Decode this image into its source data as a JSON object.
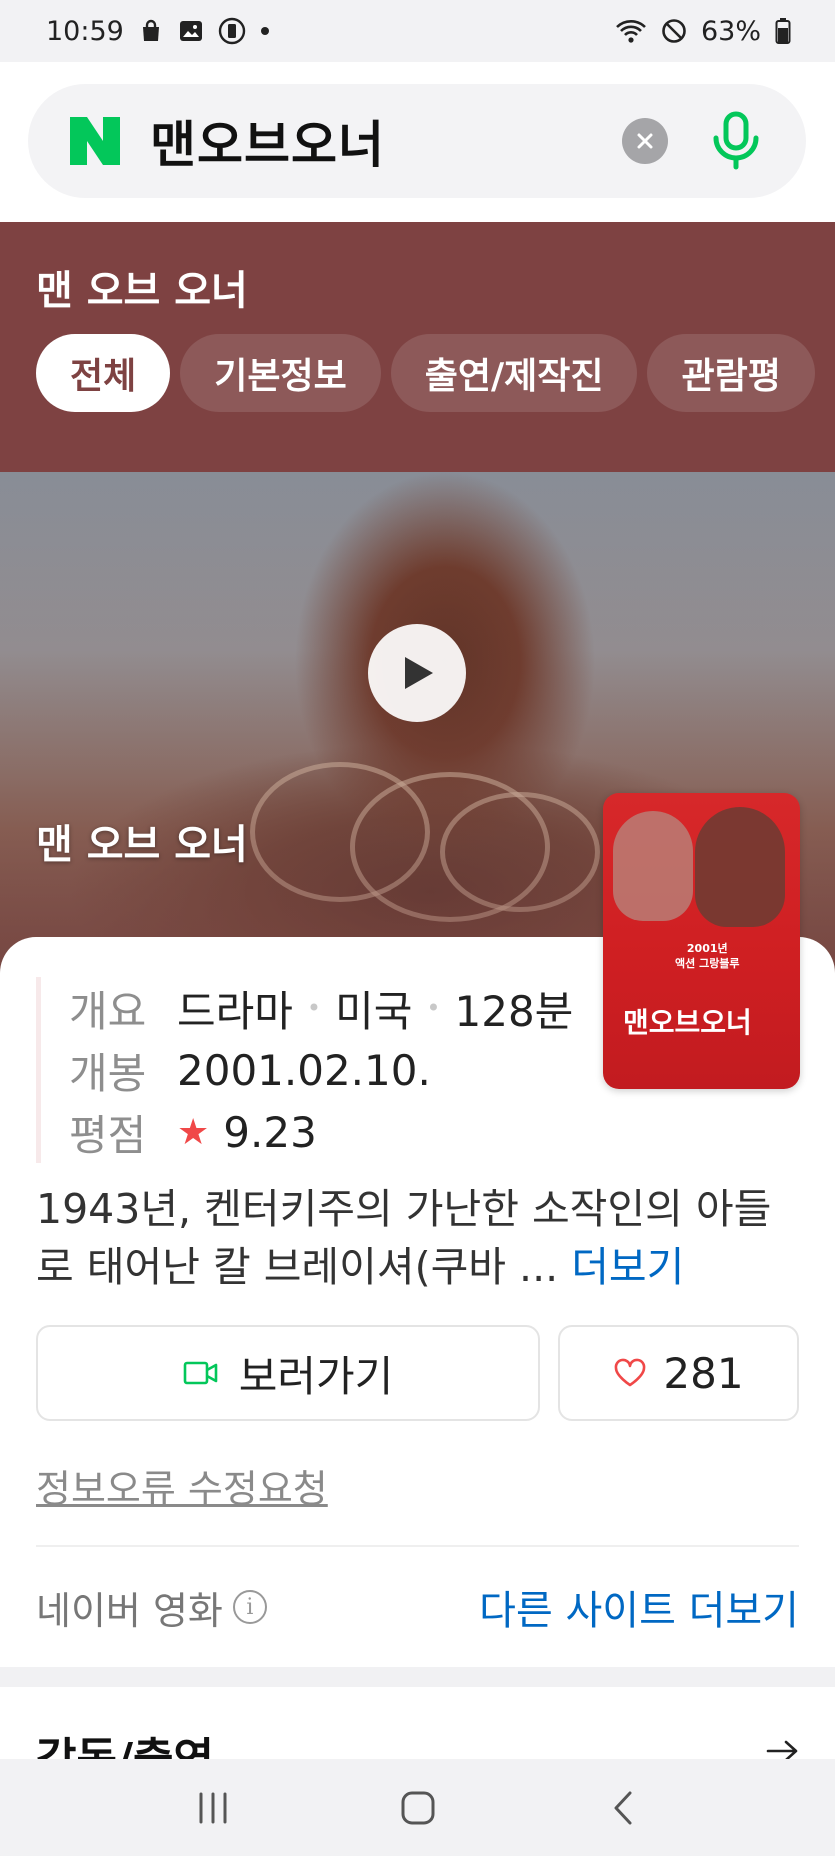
{
  "status_bar": {
    "time": "10:59",
    "battery": "63%",
    "icons": [
      "shopping-bag-icon",
      "gallery-icon",
      "vibrate-icon",
      "dot-icon",
      "wifi-icon",
      "dnd-icon",
      "battery-icon"
    ]
  },
  "search": {
    "logo": "N",
    "query": "맨오브오너",
    "clear_icon": "close-icon",
    "mic_icon": "mic-icon",
    "accent_color": "#03c75a"
  },
  "movie": {
    "title": "맨 오브 오너",
    "theme_color": "#7e4242",
    "tabs": [
      {
        "label": "전체",
        "active": true
      },
      {
        "label": "기본정보",
        "active": false
      },
      {
        "label": "출연/제작진",
        "active": false
      },
      {
        "label": "관람평",
        "active": false
      }
    ],
    "video_caption": "맨 오브 오너",
    "poster": {
      "title": "맨오브오너",
      "subtitle": "2001년\n액션 그랑블루"
    },
    "facts": [
      {
        "key": "개요",
        "values": [
          "드라마",
          "미국",
          "128분"
        ]
      },
      {
        "key": "개봉",
        "value": "2001.02.10."
      },
      {
        "key": "평점",
        "value": "9.23",
        "rating_icon": "star-icon"
      }
    ],
    "synopsis": "1943년, 켄터키주의 가난한 소작인의 아들로 태어난 칼 브레이셔(쿠바 ...",
    "more_label": "더보기",
    "watch_button": "보러가기",
    "like_count": "281",
    "report_link": "정보오류 수정요청",
    "source_label": "네이버 영화",
    "other_sites": "다른 사이트 더보기"
  },
  "next_section": {
    "title": "감독/출연"
  },
  "nav": {
    "icons": [
      "recent-apps-icon",
      "home-icon",
      "back-icon"
    ]
  }
}
